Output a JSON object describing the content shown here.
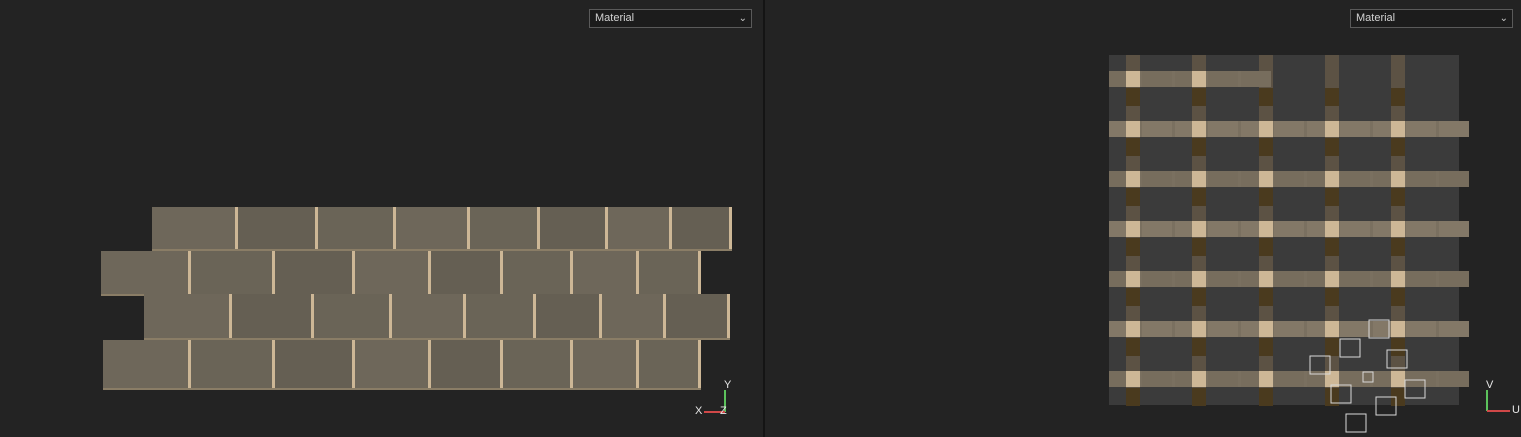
{
  "viewport_3d": {
    "shading_dropdown": {
      "value": "Material",
      "icon": "chevron-down-icon"
    },
    "axis_gizmo": {
      "y": "Y",
      "x": "X",
      "z": "Z"
    }
  },
  "viewport_uv": {
    "shading_dropdown": {
      "value": "Material",
      "icon": "chevron-down-icon"
    },
    "axis_gizmo": {
      "v": "V",
      "u": "U"
    }
  },
  "colors": {
    "background": "#232323",
    "stone": "#6a6457",
    "mortar_light": "#cdb796",
    "mortar_dark": "#4a3a1e",
    "uv_canvas": "#3b3b3b",
    "axis_x": "#d04848",
    "axis_y": "#5cc25c"
  }
}
